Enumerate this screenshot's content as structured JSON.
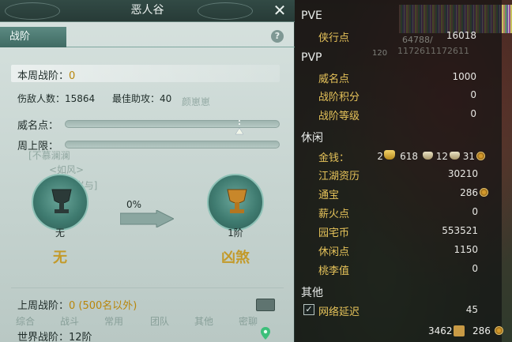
{
  "window": {
    "title": "恶人谷",
    "close_icon": "close-icon"
  },
  "tabs": [
    {
      "label": "战阶",
      "active": true
    }
  ],
  "help": {
    "glyph": "?"
  },
  "rank": {
    "week_label": "本周战阶：",
    "week_value": "0",
    "kills_label": "伤敌人数：",
    "kills_value": "15864",
    "assist_label": "最佳助攻：",
    "assist_value": "40",
    "prestige_label": "威名点：",
    "cap_label": "周上限：",
    "current_name": "无",
    "current_rank_big": "无",
    "progress_text": "0%",
    "next_name": "1阶",
    "next_rank_big": "凶煞",
    "last_week_label": "上周战阶：",
    "last_week_value": "0 (500名以外)",
    "world_label": "世界战阶：",
    "world_value": "12阶"
  },
  "bg_text": {
    "a": "颜崽崽",
    "b": "[不慕澜澜",
    "c": "<如风>",
    "d": "[岁与]",
    "e": "综合",
    "f": "战斗",
    "g": "常用",
    "h": "团队",
    "i": "其他",
    "j": "密聊"
  },
  "stats": {
    "pve": {
      "header": "PVE",
      "rows": [
        {
          "label": "侠行点",
          "value": "16018"
        }
      ]
    },
    "pvp": {
      "header": "PVP",
      "rows": [
        {
          "label": "威名点",
          "value": "1000"
        },
        {
          "label": "战阶积分",
          "value": "0"
        },
        {
          "label": "战阶等级",
          "value": "0"
        }
      ]
    },
    "leisure": {
      "header": "休闲",
      "money_label": "金钱：",
      "money_gold": "2",
      "money_silver1": "618",
      "money_silver2": "12",
      "money_copper": "31",
      "rows": [
        {
          "label": "江湖资历",
          "value": "30210"
        },
        {
          "label": "通宝",
          "value": "286"
        },
        {
          "label": "薪火点",
          "value": "0"
        },
        {
          "label": "园宅币",
          "value": "553521"
        },
        {
          "label": "休闲点",
          "value": "1150"
        },
        {
          "label": "桃李值",
          "value": "0"
        }
      ]
    },
    "other": {
      "header": "其他",
      "rows": [
        {
          "label": "网络延迟",
          "value": "45",
          "checked": true
        }
      ]
    },
    "bottom": {
      "left_value": "3462",
      "right_value": "286"
    },
    "scene_numbers": {
      "a": "64788/",
      "b": "1172611172611",
      "c": "120"
    }
  }
}
